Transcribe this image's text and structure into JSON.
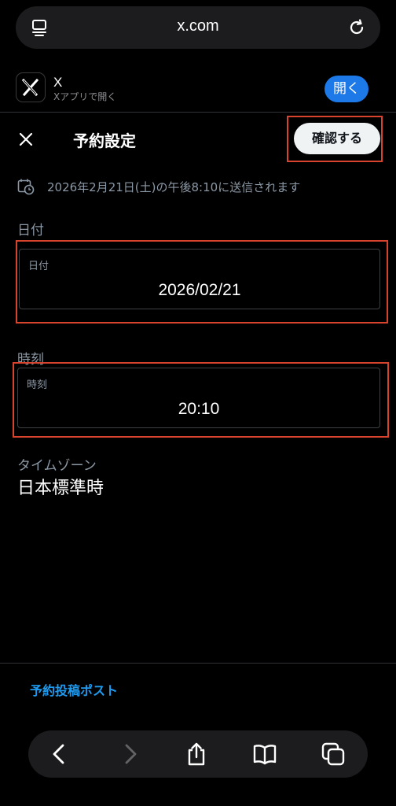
{
  "browser": {
    "url": "x.com"
  },
  "app_banner": {
    "name": "X",
    "subtitle": "Xアプリで開く",
    "open_label": "開く"
  },
  "header": {
    "title": "予約設定",
    "confirm_label": "確認する"
  },
  "summary": "2026年2月21日(土)の午後8:10に送信されます",
  "date_section": {
    "label": "日付",
    "field_label": "日付",
    "value": "2026/02/21"
  },
  "time_section": {
    "label": "時刻",
    "field_label": "時刻",
    "value": "20:10"
  },
  "timezone": {
    "label": "タイムゾーン",
    "value": "日本標準時"
  },
  "footer": {
    "scheduled_posts_link": "予約投稿ポスト"
  },
  "colors": {
    "accent_blue": "#1d9bf0",
    "open_button_blue": "#1d79e8",
    "highlight_red": "#d8432e"
  },
  "icons": [
    "tabs-icon",
    "reload-icon",
    "x-logo-icon",
    "close-icon",
    "calendar-clock-icon",
    "back-icon",
    "forward-icon",
    "share-icon",
    "bookmarks-icon",
    "tabs-overview-icon"
  ]
}
